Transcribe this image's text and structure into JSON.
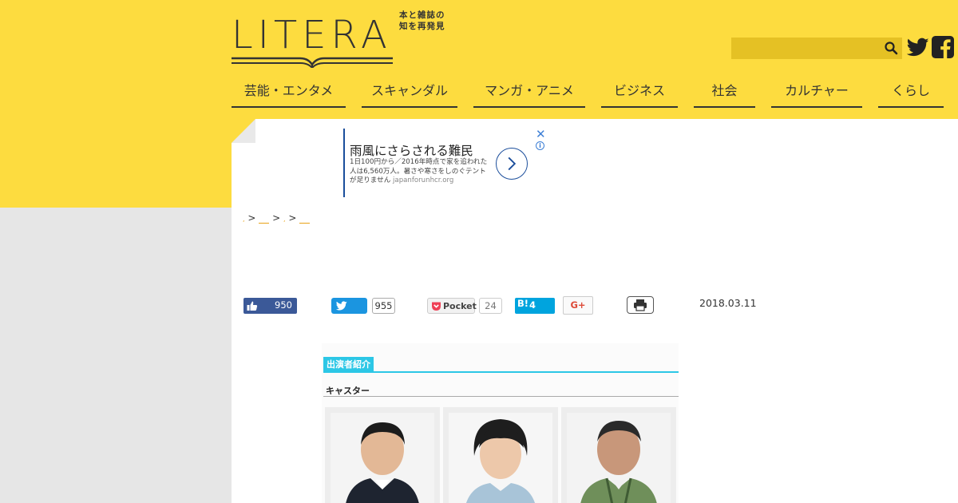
{
  "site": {
    "logo_text": "LITERA",
    "tagline": "本と雑誌の知を再発見"
  },
  "search": {
    "placeholder": "",
    "value": ""
  },
  "nav": {
    "items": [
      {
        "label": "芸能・エンタメ"
      },
      {
        "label": "スキャンダル"
      },
      {
        "label": "マンガ・アニメ"
      },
      {
        "label": "ビジネス"
      },
      {
        "label": "社会"
      },
      {
        "label": "カルチャー"
      },
      {
        "label": "くらし"
      }
    ]
  },
  "ad": {
    "title": "雨風にさらされる難民",
    "body": "1日100円から／2016年時点で家を追われた人は6,560万人。暑さや寒さをしのぐテントが足りません",
    "domain": "japanforunhcr.org",
    "close_symbol": "✕",
    "info_symbol": "i"
  },
  "breadcrumb": {
    "separator": ">"
  },
  "social": {
    "facebook_likes": "950",
    "tweet_count": "955",
    "pocket_label": "Pocket",
    "pocket_count": "24",
    "hatena_label": "B!",
    "hatena_count": "4",
    "gplus_label": "G+"
  },
  "post": {
    "date": "2018.03.11"
  },
  "article_image": {
    "section_title": "出演者紹介",
    "role_label": "キャスター"
  },
  "colors": {
    "brand_yellow": "#fddc3f",
    "search_bg": "#e5c124",
    "facebook": "#3b5998",
    "twitter": "#1b95e0",
    "hatena": "#00a4de",
    "accent_cyan": "#2cc7e6"
  }
}
